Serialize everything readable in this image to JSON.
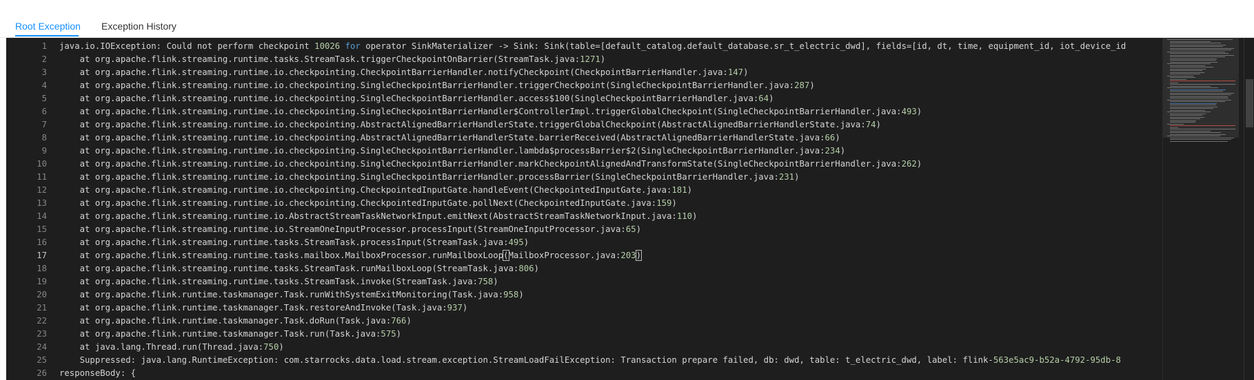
{
  "tabs": [
    {
      "label": "Root Exception",
      "active": true
    },
    {
      "label": "Exception History",
      "active": false
    }
  ],
  "editor": {
    "current_line": 17,
    "lines": [
      {
        "n": "1",
        "segs": [
          [
            "java.io.IOException: Could not perform checkpoint ",
            ""
          ],
          [
            "10026",
            "num"
          ],
          [
            " ",
            ""
          ],
          [
            "for",
            "kw"
          ],
          [
            " operator SinkMaterializer -> Sink: Sink(table=[default_catalog.default_database.sr_t_electric_dwd], fields=[id, dt, time, equipment_id, iot_device_id",
            ""
          ]
        ]
      },
      {
        "n": "2",
        "segs": [
          [
            "    at org.apache.flink.streaming.runtime.tasks.StreamTask.triggerCheckpointOnBarrier(StreamTask.java:",
            ""
          ],
          [
            "1271",
            "num"
          ],
          [
            ")",
            ""
          ]
        ]
      },
      {
        "n": "3",
        "segs": [
          [
            "    at org.apache.flink.streaming.runtime.io.checkpointing.CheckpointBarrierHandler.notifyCheckpoint(CheckpointBarrierHandler.java:",
            ""
          ],
          [
            "147",
            "num"
          ],
          [
            ")",
            ""
          ]
        ]
      },
      {
        "n": "4",
        "segs": [
          [
            "    at org.apache.flink.streaming.runtime.io.checkpointing.SingleCheckpointBarrierHandler.triggerCheckpoint(SingleCheckpointBarrierHandler.java:",
            ""
          ],
          [
            "287",
            "num"
          ],
          [
            ")",
            ""
          ]
        ]
      },
      {
        "n": "5",
        "segs": [
          [
            "    at org.apache.flink.streaming.runtime.io.checkpointing.SingleCheckpointBarrierHandler.access$100(SingleCheckpointBarrierHandler.java:",
            ""
          ],
          [
            "64",
            "num"
          ],
          [
            ")",
            ""
          ]
        ]
      },
      {
        "n": "6",
        "segs": [
          [
            "    at org.apache.flink.streaming.runtime.io.checkpointing.SingleCheckpointBarrierHandler$ControllerImpl.triggerGlobalCheckpoint(SingleCheckpointBarrierHandler.java:",
            ""
          ],
          [
            "493",
            "num"
          ],
          [
            ")",
            ""
          ]
        ]
      },
      {
        "n": "7",
        "segs": [
          [
            "    at org.apache.flink.streaming.runtime.io.checkpointing.AbstractAlignedBarrierHandlerState.triggerGlobalCheckpoint(AbstractAlignedBarrierHandlerState.java:",
            ""
          ],
          [
            "74",
            "num"
          ],
          [
            ")",
            ""
          ]
        ]
      },
      {
        "n": "8",
        "segs": [
          [
            "    at org.apache.flink.streaming.runtime.io.checkpointing.AbstractAlignedBarrierHandlerState.barrierReceived(AbstractAlignedBarrierHandlerState.java:",
            ""
          ],
          [
            "66",
            "num"
          ],
          [
            ")",
            ""
          ]
        ]
      },
      {
        "n": "9",
        "segs": [
          [
            "    at org.apache.flink.streaming.runtime.io.checkpointing.SingleCheckpointBarrierHandler.lambda$processBarrier$2(SingleCheckpointBarrierHandler.java:",
            ""
          ],
          [
            "234",
            "num"
          ],
          [
            ")",
            ""
          ]
        ]
      },
      {
        "n": "10",
        "segs": [
          [
            "    at org.apache.flink.streaming.runtime.io.checkpointing.SingleCheckpointBarrierHandler.markCheckpointAlignedAndTransformState(SingleCheckpointBarrierHandler.java:",
            ""
          ],
          [
            "262",
            "num"
          ],
          [
            ")",
            ""
          ]
        ]
      },
      {
        "n": "11",
        "segs": [
          [
            "    at org.apache.flink.streaming.runtime.io.checkpointing.SingleCheckpointBarrierHandler.processBarrier(SingleCheckpointBarrierHandler.java:",
            ""
          ],
          [
            "231",
            "num"
          ],
          [
            ")",
            ""
          ]
        ]
      },
      {
        "n": "12",
        "segs": [
          [
            "    at org.apache.flink.streaming.runtime.io.checkpointing.CheckpointedInputGate.handleEvent(CheckpointedInputGate.java:",
            ""
          ],
          [
            "181",
            "num"
          ],
          [
            ")",
            ""
          ]
        ]
      },
      {
        "n": "13",
        "segs": [
          [
            "    at org.apache.flink.streaming.runtime.io.checkpointing.CheckpointedInputGate.pollNext(CheckpointedInputGate.java:",
            ""
          ],
          [
            "159",
            "num"
          ],
          [
            ")",
            ""
          ]
        ]
      },
      {
        "n": "14",
        "segs": [
          [
            "    at org.apache.flink.streaming.runtime.io.AbstractStreamTaskNetworkInput.emitNext(AbstractStreamTaskNetworkInput.java:",
            ""
          ],
          [
            "110",
            "num"
          ],
          [
            ")",
            ""
          ]
        ]
      },
      {
        "n": "15",
        "segs": [
          [
            "    at org.apache.flink.streaming.runtime.io.StreamOneInputProcessor.processInput(StreamOneInputProcessor.java:",
            ""
          ],
          [
            "65",
            "num"
          ],
          [
            ")",
            ""
          ]
        ]
      },
      {
        "n": "16",
        "segs": [
          [
            "    at org.apache.flink.streaming.runtime.tasks.StreamTask.processInput(StreamTask.java:",
            ""
          ],
          [
            "495",
            "num"
          ],
          [
            ")",
            ""
          ]
        ]
      },
      {
        "n": "17",
        "segs": [
          [
            "    at org.apache.flink.streaming.runtime.tasks.mailbox.MailboxProcessor.runMailboxLoop",
            ""
          ],
          [
            "(",
            "cur"
          ],
          [
            "MailboxProcessor.java:",
            ""
          ],
          [
            "203",
            "num"
          ],
          [
            ")",
            "cur"
          ]
        ]
      },
      {
        "n": "18",
        "segs": [
          [
            "    at org.apache.flink.streaming.runtime.tasks.StreamTask.runMailboxLoop(StreamTask.java:",
            ""
          ],
          [
            "806",
            "num"
          ],
          [
            ")",
            ""
          ]
        ]
      },
      {
        "n": "19",
        "segs": [
          [
            "    at org.apache.flink.streaming.runtime.tasks.StreamTask.invoke(StreamTask.java:",
            ""
          ],
          [
            "758",
            "num"
          ],
          [
            ")",
            ""
          ]
        ]
      },
      {
        "n": "20",
        "segs": [
          [
            "    at org.apache.flink.runtime.taskmanager.Task.runWithSystemExitMonitoring(Task.java:",
            ""
          ],
          [
            "958",
            "num"
          ],
          [
            ")",
            ""
          ]
        ]
      },
      {
        "n": "21",
        "segs": [
          [
            "    at org.apache.flink.runtime.taskmanager.Task.restoreAndInvoke(Task.java:",
            ""
          ],
          [
            "937",
            "num"
          ],
          [
            ")",
            ""
          ]
        ]
      },
      {
        "n": "22",
        "segs": [
          [
            "    at org.apache.flink.runtime.taskmanager.Task.doRun(Task.java:",
            ""
          ],
          [
            "766",
            "num"
          ],
          [
            ")",
            ""
          ]
        ]
      },
      {
        "n": "23",
        "segs": [
          [
            "    at org.apache.flink.runtime.taskmanager.Task.run(Task.java:",
            ""
          ],
          [
            "575",
            "num"
          ],
          [
            ")",
            ""
          ]
        ]
      },
      {
        "n": "24",
        "segs": [
          [
            "    at java.lang.Thread.run(Thread.java:",
            ""
          ],
          [
            "750",
            "num"
          ],
          [
            ")",
            ""
          ]
        ]
      },
      {
        "n": "25",
        "segs": [
          [
            "    Suppressed: java.lang.RuntimeException: com.starrocks.data.load.stream.exception.StreamLoadFailException: Transaction prepare failed, db: dwd, table: t_electric_dwd, label: flink-",
            ""
          ],
          [
            "563e5ac9-b52a-4792-95db-8",
            "num"
          ]
        ]
      },
      {
        "n": "26",
        "segs": [
          [
            "responseBody: {",
            ""
          ]
        ]
      }
    ]
  }
}
